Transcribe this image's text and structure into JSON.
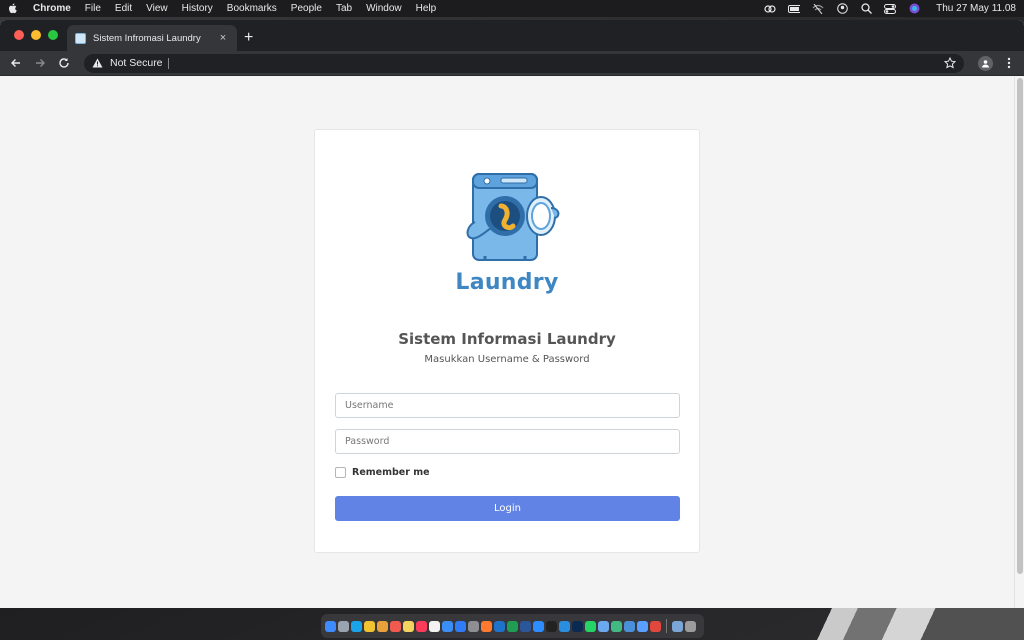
{
  "menubar": {
    "app_name": "Chrome",
    "items": [
      "File",
      "Edit",
      "View",
      "History",
      "Bookmarks",
      "People",
      "Tab",
      "Window",
      "Help"
    ],
    "clock": "Thu 27 May  11.08"
  },
  "browser": {
    "tab_title": "Sistem Infromasi Laundry",
    "tab_close": "×",
    "new_tab": "+",
    "security_label": "Not Secure"
  },
  "page": {
    "brand": "Laundry",
    "heading": "Sistem Informasi Laundry",
    "subheading": "Masukkan Username & Password",
    "username_placeholder": "Username",
    "password_placeholder": "Password",
    "remember_label": "Remember me",
    "login_label": "Login"
  },
  "colors": {
    "accent": "#6283e6",
    "brand": "#3f87c2"
  },
  "dock": {
    "apps": [
      "finder-icon",
      "launchpad-icon",
      "safari-icon",
      "chrome-icon",
      "photos-icon",
      "calendar-icon",
      "notes-icon",
      "music-icon",
      "reminders-icon",
      "mail-icon",
      "app-store-icon",
      "system-preferences-icon",
      "firefox-icon",
      "outlook-icon",
      "excel-icon",
      "word-icon",
      "zoom-icon",
      "terminal-icon",
      "vscode-icon",
      "photoshop-icon",
      "whatsapp-icon",
      "preview-icon",
      "activity-icon",
      "xcode-icon",
      "vmware-icon",
      "chrome-icon-2",
      "downloads-icon",
      "trash-icon"
    ]
  }
}
